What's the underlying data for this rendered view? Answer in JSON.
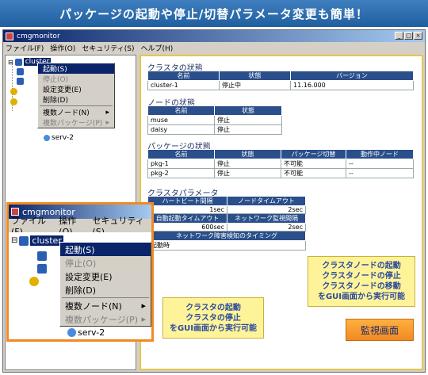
{
  "banner": "パッケージの起動や停止/切替パラメータ変更も簡単！",
  "window": {
    "title": "cmgmonitor"
  },
  "menubar": [
    "ファイル(F)",
    "操作(O)",
    "セキュリティ(S)",
    "ヘルプ(H)"
  ],
  "tree": {
    "root": "cluster",
    "leaf": "serv-2"
  },
  "context_menu": {
    "items": [
      {
        "label": "起動(S)",
        "state": "highlighted"
      },
      {
        "label": "停止(O)",
        "state": "disabled"
      },
      {
        "label": "設定変更(E)",
        "state": "normal"
      },
      {
        "label": "削除(D)",
        "state": "normal"
      },
      {
        "label": "複数ノード(N)",
        "state": "submenu"
      },
      {
        "label": "複数パッケージ(P)",
        "state": "disabled-submenu"
      }
    ]
  },
  "cluster_status": {
    "title": "クラスタの状態",
    "headers": [
      "名前",
      "状態",
      "バージョン"
    ],
    "rows": [
      [
        "cluster-1",
        "停止中",
        "11.16.000"
      ]
    ]
  },
  "node_status": {
    "title": "ノードの状態",
    "headers": [
      "名前",
      "状態"
    ],
    "rows": [
      [
        "muse",
        "停止"
      ],
      [
        "daisy",
        "停止"
      ]
    ]
  },
  "package_status": {
    "title": "パッケージの状態",
    "headers": [
      "名前",
      "状態",
      "パッケージ切替",
      "動作中ノード"
    ],
    "rows": [
      [
        "pkg-1",
        "停止",
        "不可能",
        "--"
      ],
      [
        "pkg-2",
        "停止",
        "不可能",
        "--"
      ]
    ]
  },
  "cluster_params": {
    "title": "クラスタパラメータ",
    "h1": [
      "ハートビート間隔",
      "ノードタイムアウト"
    ],
    "r1": [
      "1sec",
      "2sec"
    ],
    "h2": [
      "自動起動タイムアウト",
      "ネットワーク監視間隔"
    ],
    "r2": [
      "600sec",
      "2sec"
    ],
    "h3": "ネットワーク障害検知のタイミング",
    "r3": "起動時"
  },
  "zoom": {
    "title": "cmgmonitor",
    "menubar": [
      "ファイル(F)",
      "操作(O)",
      "セキュリティ(S)"
    ],
    "root": "cluster",
    "leaf": "serv-2",
    "menu": [
      "起動(S)",
      "停止(O)",
      "設定変更(E)",
      "削除(D)",
      "複数ノード(N)",
      "複数パッケージ(P)"
    ]
  },
  "callout_cluster": [
    "クラスタの起動",
    "クラスタの停止",
    "をGUI画面から実行可能"
  ],
  "callout_node": [
    "クラスタノードの起動",
    "クラスタノードの停止",
    "クラスタノードの移動",
    "をGUI画面から実行可能"
  ],
  "monitor_button": "監視画面",
  "colors": {
    "banner": "#2f6faf",
    "highlight": "#0a246a",
    "accent": "#f08a24",
    "callout": "#fff39a"
  }
}
